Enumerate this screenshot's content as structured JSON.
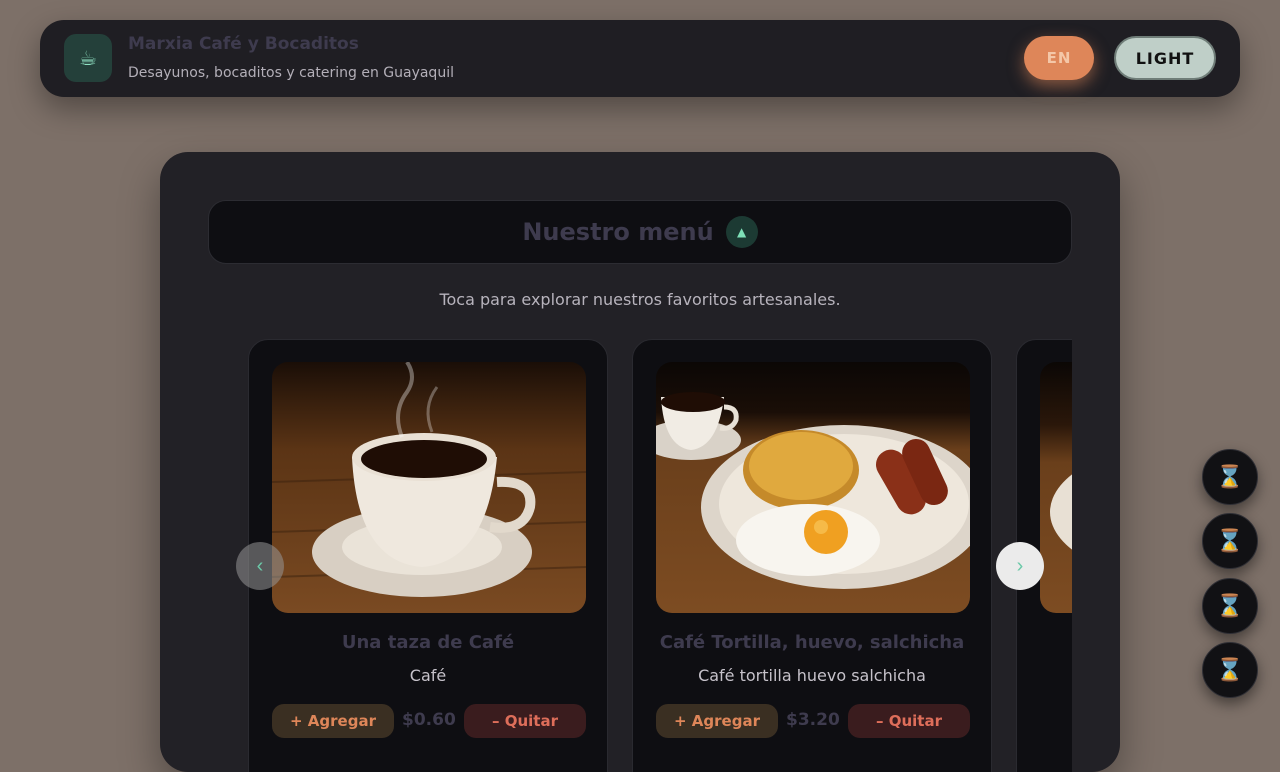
{
  "header": {
    "logo_icon": "coffee-icon",
    "title": "Marxia Café y Bocaditos",
    "subtitle": "Desayunos, bocaditos y catering en Guayaquil",
    "lang_label": "EN",
    "theme_label": "LIGHT"
  },
  "menu": {
    "title": "Nuestro menú",
    "toggle_icon": "chevron-up-icon",
    "subtitle": "Toca para explorar nuestros favoritos artesanales.",
    "add_label": "+ Agregar",
    "remove_label": "– Quitar",
    "items": [
      {
        "name": "Una taza de Café",
        "description": "Café",
        "price": "$0.60"
      },
      {
        "name": "Café Tortilla, huevo, salchicha",
        "description": "Café tortilla huevo salchicha",
        "price": "$3.20"
      }
    ]
  },
  "carousel": {
    "prev_icon": "chevron-left-icon",
    "next_icon": "chevron-right-icon"
  },
  "floating_actions": [
    {
      "icon": "hourglass-icon"
    },
    {
      "icon": "hourglass-icon"
    },
    {
      "icon": "hourglass-icon"
    },
    {
      "icon": "hourglass-icon"
    }
  ],
  "colors": {
    "accent": "#de8659",
    "mint": "#6bc9a8",
    "panel": "#222126"
  }
}
